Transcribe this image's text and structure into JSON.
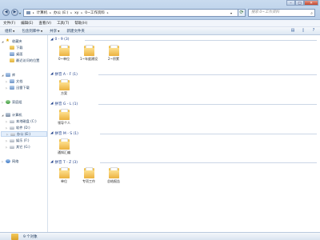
{
  "address": {
    "crumbs": [
      "计算机",
      "办公 (E:)",
      "xy",
      "0~工作资料"
    ],
    "search_placeholder": "搜索 0~工作资料"
  },
  "window_buttons": {
    "minimize": "–",
    "maximize": "□",
    "close": "✕"
  },
  "menu": [
    "文件(F)",
    "编辑(E)",
    "查看(V)",
    "工具(T)",
    "帮助(H)"
  ],
  "toolbar": {
    "organize": "组织",
    "include_library": "包含到库中",
    "share": "共享",
    "new_folder": "新建文件夹"
  },
  "nav": {
    "favorites": "收藏夹",
    "favorites_items": [
      "下载",
      "桌面",
      "最近访问的位置"
    ],
    "libraries": "库",
    "library_items": [
      "文档",
      "迅雷下载"
    ],
    "homegroup": "家庭组",
    "computer": "计算机",
    "drives": [
      "本地磁盘 (C:)",
      "软件 (D:)",
      "办公 (E:)",
      "娱乐 (F:)",
      "其它 (G:)"
    ],
    "network": "网络"
  },
  "groups": [
    {
      "header": "0 - 9 (3)",
      "items": [
        "0~单位",
        "1~年度建设",
        "2~积累"
      ]
    },
    {
      "header": "拼音 A - F (1)",
      "items": [
        "方案"
      ]
    },
    {
      "header": "拼音 G - L (1)",
      "items": [
        "领导个人"
      ]
    },
    {
      "header": "拼音 M - S (1)",
      "items": [
        "通知汇编"
      ]
    },
    {
      "header": "拼音 T - Z (3)",
      "items": [
        "单位",
        "专项工作",
        "总结报告"
      ]
    }
  ],
  "status": {
    "count": "9 个对象"
  }
}
